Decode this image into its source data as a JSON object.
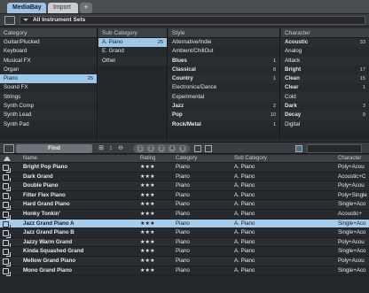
{
  "tabs": [
    "MediaBay",
    "Import"
  ],
  "tab_add": "+",
  "set_selector": "All Instrument Sets",
  "columns": {
    "category": {
      "header": "Category",
      "items": [
        {
          "label": "Guitar/Plucked",
          "count": ""
        },
        {
          "label": "Keyboard",
          "count": ""
        },
        {
          "label": "Musical FX",
          "count": ""
        },
        {
          "label": "Organ",
          "count": ""
        },
        {
          "label": "Piano",
          "count": "25"
        },
        {
          "label": "Sound FX",
          "count": ""
        },
        {
          "label": "Strings",
          "count": ""
        },
        {
          "label": "Synth Comp",
          "count": ""
        },
        {
          "label": "Synth Lead",
          "count": ""
        },
        {
          "label": "Synth Pad",
          "count": ""
        }
      ]
    },
    "subcategory": {
      "header": "Sub Category",
      "items": [
        {
          "label": "A. Piano",
          "count": "25"
        },
        {
          "label": "E. Grand",
          "count": ""
        },
        {
          "label": "Other",
          "count": ""
        }
      ]
    },
    "style": {
      "header": "Style",
      "items": [
        {
          "label": "Alternative/Indie",
          "count": ""
        },
        {
          "label": "Ambient/ChillOut",
          "count": ""
        },
        {
          "label": "Blues",
          "count": "1"
        },
        {
          "label": "Classical",
          "count": "8"
        },
        {
          "label": "Country",
          "count": "1"
        },
        {
          "label": "Electronica/Dance",
          "count": ""
        },
        {
          "label": "Experimental",
          "count": ""
        },
        {
          "label": "Jazz",
          "count": "2"
        },
        {
          "label": "Pop",
          "count": "10"
        },
        {
          "label": "Rock/Metal",
          "count": "1"
        }
      ]
    },
    "character": {
      "header": "Character",
      "items": [
        {
          "label": "Acoustic",
          "count": "33"
        },
        {
          "label": "Analog",
          "count": ""
        },
        {
          "label": "Attack",
          "count": ""
        },
        {
          "label": "Bright",
          "count": "17"
        },
        {
          "label": "Clean",
          "count": "15"
        },
        {
          "label": "Clear",
          "count": "1"
        },
        {
          "label": "Cold",
          "count": ""
        },
        {
          "label": "Dark",
          "count": "3"
        },
        {
          "label": "Decay",
          "count": "9"
        },
        {
          "label": "Digital",
          "count": ""
        }
      ]
    }
  },
  "find": {
    "button": "Find",
    "pager": [
      "1",
      "2",
      "3",
      "4",
      "5"
    ]
  },
  "grid": {
    "headers": [
      "Name",
      "Rating",
      "Category",
      "Sub Category",
      "Character"
    ],
    "rows": [
      {
        "name": "Bright Pop Piano",
        "rating": "★★★",
        "category": "Piano",
        "sub": "A. Piano",
        "character": "Poly+Acou"
      },
      {
        "name": "Dark Grand",
        "rating": "★★★",
        "category": "Piano",
        "sub": "A. Piano",
        "character": "Acoustic+C"
      },
      {
        "name": "Double Piano",
        "rating": "★★★",
        "category": "Piano",
        "sub": "A. Piano",
        "character": "Poly+Acou"
      },
      {
        "name": "Filter Flex Piano",
        "rating": "★★★",
        "category": "Piano",
        "sub": "A. Piano",
        "character": "Poly+Single"
      },
      {
        "name": "Hard Grand Piano",
        "rating": "★★★",
        "category": "Piano",
        "sub": "A. Piano",
        "character": "Single+Aco"
      },
      {
        "name": "Honky Tonkin'",
        "rating": "★★★",
        "category": "Piano",
        "sub": "A. Piano",
        "character": "Acoustic+"
      },
      {
        "name": "Jazz Grand Piano A",
        "rating": "★★★",
        "category": "Piano",
        "sub": "A. Piano",
        "character": "Single+Aco",
        "selected": true
      },
      {
        "name": "Jazz Grand Piano B",
        "rating": "★★★",
        "category": "Piano",
        "sub": "A. Piano",
        "character": "Single+Aco"
      },
      {
        "name": "Jazzy Warm Grand",
        "rating": "★★★",
        "category": "Piano",
        "sub": "A. Piano",
        "character": "Poly+Acou"
      },
      {
        "name": "Kinda Squashed Grand",
        "rating": "★★★",
        "category": "Piano",
        "sub": "A. Piano",
        "character": "Single+Aco"
      },
      {
        "name": "Mellow Grand Piano",
        "rating": "★★★",
        "category": "Piano",
        "sub": "A. Piano",
        "character": "Poly+Acou"
      },
      {
        "name": "Mono Grand Piano",
        "rating": "★★★",
        "category": "Piano",
        "sub": "A. Piano",
        "character": "Single+Aco"
      }
    ]
  },
  "colors": {
    "selection": "#9ec8ea",
    "background": "#23262a",
    "header": "#3c4146"
  },
  "icons": [
    "set-icon",
    "filter-icon",
    "find-options-icon",
    "preset-icon"
  ]
}
